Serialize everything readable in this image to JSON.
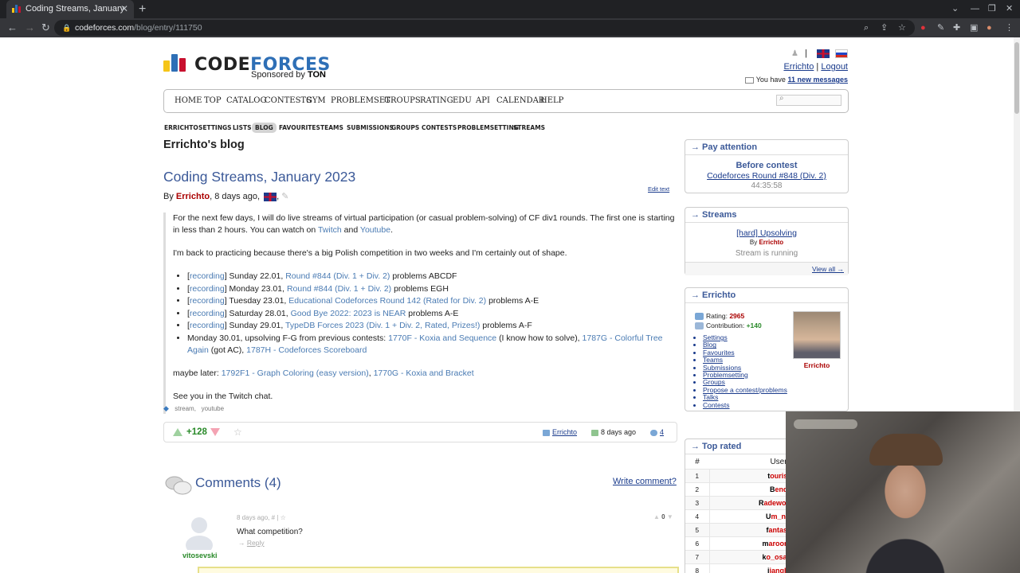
{
  "browser": {
    "tab_title": "Coding Streams, January",
    "tab_close": "✕",
    "new_tab": "+",
    "url_host": "codeforces.com",
    "url_path": "/blog/entry/111750"
  },
  "header": {
    "logo_part1": "CODE",
    "logo_part2": "FORCES",
    "sponsored_by": "Sponsored by",
    "sponsor": "TON",
    "user_link": "Errichto",
    "separator": "|",
    "logout_link": "Logout",
    "messages_prefix": "You have",
    "messages_link": "11 new messages"
  },
  "main_menu": [
    "HOME",
    "TOP",
    "CATALOG",
    "CONTESTS",
    "GYM",
    "PROBLEMSET",
    "GROUPS",
    "RATING",
    "EDU",
    "API",
    "CALENDAR",
    "HELP"
  ],
  "sub_menu": [
    "ERRICHTO",
    "SETTINGS",
    "LISTS",
    "BLOG",
    "FAVOURITES",
    "TEAMS",
    "SUBMISSIONS",
    "GROUPS",
    "CONTESTS",
    "PROBLEMSETTING",
    "STREAMS"
  ],
  "sub_menu_active": "BLOG",
  "blog": {
    "owner_title": "Errichto's blog",
    "entry_title": "Coding Streams, January 2023",
    "by": "By",
    "author": "Errichto",
    "age": ", 8 days ago,",
    "edit_text": "Edit text",
    "intro_1": "For the next few days, I will do live streams of virtual participation (or casual problem-solving) of CF div1 rounds. The first one is starting in less than 2 hours. You can watch on",
    "intro_twitch": "Twitch",
    "intro_and": "and",
    "intro_youtube": "Youtube",
    "intro_end": ".",
    "para_2": "I'm back to practicing because there's a big Polish competition in two weeks and I'm certainly out of shape.",
    "items": [
      {
        "rec": "recording",
        "date": "Sunday 22.01,",
        "link": "Round #844 (Div. 1 + Div. 2)",
        "tail": "problems ABCDF"
      },
      {
        "rec": "recording",
        "date": "Monday 23.01,",
        "link": "Round #844 (Div. 1 + Div. 2)",
        "tail": "problems EGH"
      },
      {
        "rec": "recording",
        "date": "Tuesday 23.01,",
        "link": "Educational Codeforces Round 142 (Rated for Div. 2)",
        "tail": "problems A-E"
      },
      {
        "rec": "recording",
        "date": "Saturday 28.01,",
        "link": "Good Bye 2022: 2023 is NEAR",
        "tail": "problems A-E"
      },
      {
        "rec": "recording",
        "date": "Sunday 29.01,",
        "link": "TypeDB Forces 2023 (Div. 1 + Div. 2, Rated, Prizes!)",
        "tail": "problems A-F"
      }
    ],
    "last_item_text": "Monday 30.01, upsolving F-G from previous contests:",
    "last_item_link1": "1770F - Koxia and Sequence",
    "last_item_mid": "(I know how to solve),",
    "last_item_link2": "1787G - Colorful Tree Again",
    "last_item_got": "(got AC),",
    "last_item_link3": "1787H - Codeforces Scoreboard",
    "maybe_prefix": "maybe later:",
    "maybe_link1": "1792F1 - Graph Coloring (easy version)",
    "maybe_comma": ",",
    "maybe_link2": "1770G - Koxia and Bracket",
    "see_you": "See you in the Twitch chat.",
    "tags": [
      "stream",
      "youtube"
    ],
    "rating": "+128",
    "footer_user": "Errichto",
    "footer_date": "8 days ago",
    "footer_comments": "4"
  },
  "comments": {
    "title": "Comments (4)",
    "write_link": "Write comment?",
    "first": {
      "user": "vitosevski",
      "meta": "8 days ago,  #  |",
      "text": "What competition?",
      "reply_arrow": "→",
      "reply": "Reply",
      "votes": "0"
    }
  },
  "sidebar": {
    "pay_attention": {
      "heading": "→ Pay attention",
      "before": "Before contest",
      "contest": "Codeforces Round #848 (Div. 2)",
      "timer": "44:35:58"
    },
    "streams": {
      "heading": "→ Streams",
      "title": "[hard] Upsolving",
      "by": "By",
      "by_user": "Errichto",
      "status": "Stream is running",
      "view_all": "View all →"
    },
    "profile": {
      "heading": "→ Errichto",
      "rating_label": "Rating:",
      "rating": "2965",
      "contribution_label": "Contribution:",
      "contribution": "+140",
      "links": [
        "Settings",
        "Blog",
        "Favourites",
        "Teams",
        "Submissions",
        "Problemsetting",
        "Groups",
        "Propose a contest/problems",
        "Talks",
        "Contests"
      ],
      "name": "Errichto"
    },
    "top_rated": {
      "heading": "→ Top rated",
      "col_num": "#",
      "col_user": "User",
      "rows": [
        {
          "n": "1",
          "first": "t",
          "rest": "ourist"
        },
        {
          "n": "2",
          "first": "B",
          "rest": "enq"
        },
        {
          "n": "3",
          "first": "R",
          "rest": "adewoosh"
        },
        {
          "n": "4",
          "first": "U",
          "rest": "m_nik"
        },
        {
          "n": "5",
          "first": "f",
          "rest": "antasy"
        },
        {
          "n": "6",
          "first": "m",
          "rest": "aroonrk"
        },
        {
          "n": "7",
          "first": "k",
          "rest": "o_osaga"
        },
        {
          "n": "8",
          "first": "j",
          "rest": "iangly"
        }
      ]
    }
  },
  "colors": {
    "title_blue": "#3b5998",
    "link_blue": "#4a7bb3",
    "red_user": "#aa0000",
    "green_rating": "#2a8a2a"
  }
}
